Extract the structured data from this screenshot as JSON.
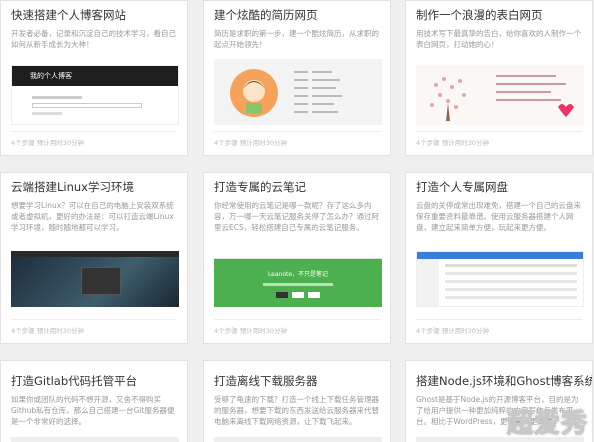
{
  "cards": [
    {
      "title": "快速搭建个人博客网站",
      "desc": "开发者必备，记录和沉淀自己的技术学习，看自己如何从新手成长为大神！",
      "meta": "4个步骤  预计用时30分钟",
      "thumb_text": "我的个人博客"
    },
    {
      "title": "建个炫酷的简历网页",
      "desc": "简历是求职的第一步，建一个酷炫简历，从求职的起点开始领先！",
      "meta": "4个步骤  预计用时30分钟",
      "thumb_text": ""
    },
    {
      "title": "制作一个浪漫的表白网页",
      "desc": "用技术写下最真挚的告白，给你喜欢的人制作一个表白网页，打动她的心！",
      "meta": "4个步骤  预计用时30分钟",
      "thumb_text": ""
    },
    {
      "title": "云端搭建Linux学习环境",
      "desc": "想要学习Linux？可以在自己的电脑上安装双系统或者虚拟机，更好的办法是：可以打造云端Linux学习环境，随时随地都可以学习。",
      "meta": "4个步骤  预计用时30分钟",
      "thumb_text": ""
    },
    {
      "title": "打造专属的云笔记",
      "desc": "你经常使用的云笔记是哪一款呢？存了这么多内容，万一哪一天云笔记服务关停了怎么办？通过阿里云ECS，轻松搭建自己专属的云笔记服务。",
      "meta": "4个步骤  预计用时30分钟",
      "thumb_text": "Leanote，不只是笔记"
    },
    {
      "title": "打造个人专属网盘",
      "desc": "云盘的关停成常出现难免，搭建一个自己的云盘来保存重要资料最靠谱。使用云服务器搭建个人网盘，建立起来简单方便，玩起来更方便。",
      "meta": "4个步骤  预计用时30分钟",
      "thumb_text": ""
    },
    {
      "title": "打造Gitlab代码托管平台",
      "desc": "如果你或团队的代码不想开源，又舍不得购买Github私有仓库，那么自己搭建一台Git服务器便是一个非常好的选择。",
      "meta": "",
      "thumb_text": ""
    },
    {
      "title": "打造离线下载服务器",
      "desc": "受够了龟速的下载？打造一个线上下载任务管理器的服务器，想要下载的东西发送给云服务器来代替电脑来离线下载网络资源，让下载飞起来。",
      "meta": "",
      "thumb_text": ""
    },
    {
      "title": "搭建Node.js环境和Ghost博客系统",
      "desc": "Ghost是基于Node.js的开源博客平台，目的是为了给用户提供一种更加纯粹的内容写作与发布平台。相比于WordPress，更轻量，更简洁。",
      "meta": "",
      "thumb_text": ""
    }
  ],
  "watermark": "超爱秀",
  "colors": {
    "title": "#333333",
    "desc": "#999999",
    "meta": "#bbbbbb",
    "border": "#e2e2e2",
    "accent_green": "#4caf50",
    "avatar_orange": "#f5a35c"
  }
}
